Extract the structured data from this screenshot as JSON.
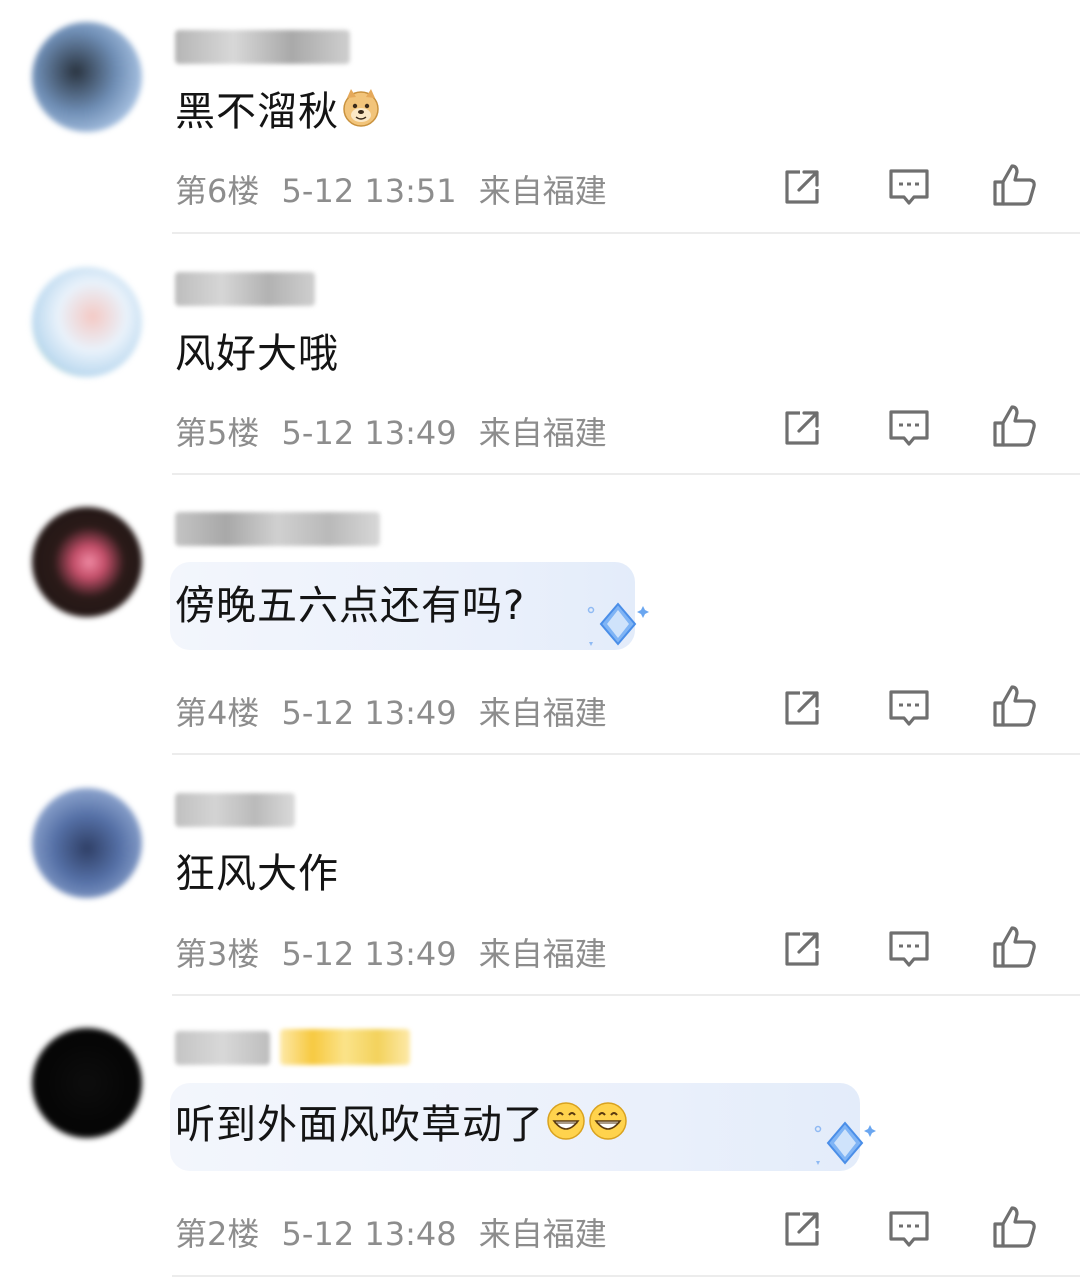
{
  "comments": [
    {
      "text": "黑不溜秋",
      "emoji": [
        "doge-emoji-icon"
      ],
      "floor": "第6楼",
      "time": "5-12 13:51",
      "location": "来自福建"
    },
    {
      "text": "风好大哦",
      "emoji": [],
      "floor": "第5楼",
      "time": "5-12 13:49",
      "location": "来自福建"
    },
    {
      "text": "傍晚五六点还有吗?",
      "emoji": [],
      "floor": "第4楼",
      "time": "5-12 13:49",
      "location": "来自福建",
      "bubble": true
    },
    {
      "text": "狂风大作",
      "emoji": [],
      "floor": "第3楼",
      "time": "5-12 13:49",
      "location": "来自福建"
    },
    {
      "text": "听到外面风吹草动了",
      "emoji": [
        "grin-emoji-icon",
        "grin-emoji-icon"
      ],
      "floor": "第2楼",
      "time": "5-12 13:48",
      "location": "来自福建",
      "bubble": true
    }
  ],
  "icons": {
    "share": "share-icon",
    "reply": "reply-icon",
    "like": "thumbs-up-icon"
  },
  "colors": {
    "text": "#141414",
    "meta": "#8d8d8d",
    "icon": "#6f6f6f",
    "divider": "#ececec",
    "bubble": "#eaf0fb",
    "gem": "#5b9bf0"
  }
}
